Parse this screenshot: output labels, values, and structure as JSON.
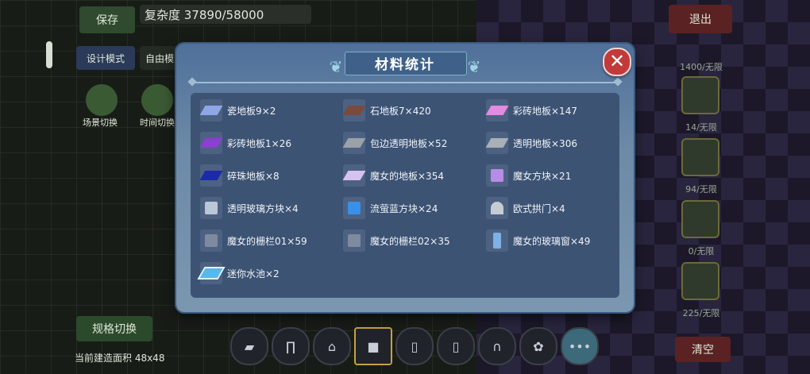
{
  "hud": {
    "save": "保存",
    "complexity": "复杂度 37890/58000",
    "design_mode": "设计模式",
    "free_mode": "自由模",
    "scene_switch": "场景切换",
    "time_switch": "时间切换",
    "spec_switch": "规格切换",
    "build_area": "当前建造面积 48x48",
    "exit": "退出",
    "clear": "清空",
    "right_counts": [
      "1400/无限",
      "14/无限",
      "94/无限",
      "0/无限",
      "225/无限"
    ]
  },
  "modal": {
    "title": "材料统计",
    "close_label": "✕",
    "items": [
      {
        "label": "瓷地板9×2",
        "icon": "tile-floor-icon",
        "color": "#8fa6e6"
      },
      {
        "label": "石地板7×420",
        "icon": "stone-floor-icon",
        "color": "#7a4a3c"
      },
      {
        "label": "彩砖地板×147",
        "icon": "color-brick-floor-icon",
        "color": "#e48ae0"
      },
      {
        "label": "彩砖地板1×26",
        "icon": "color-brick-floor-icon",
        "color": "#8c3fd0"
      },
      {
        "label": "包边透明地板×52",
        "icon": "edged-transparent-floor-icon",
        "color": "#9aa1a8"
      },
      {
        "label": "透明地板×306",
        "icon": "transparent-floor-icon",
        "color": "#a8b0b6"
      },
      {
        "label": "碎珠地板×8",
        "icon": "bead-floor-icon",
        "color": "#1c2aa8"
      },
      {
        "label": "魔女的地板×354",
        "icon": "witch-floor-icon",
        "color": "#d5c2f0"
      },
      {
        "label": "魔女方块×21",
        "icon": "witch-block-icon",
        "color": "#b88ce6"
      },
      {
        "label": "透明玻璃方块×4",
        "icon": "glass-block-icon",
        "color": "#b9c7d6"
      },
      {
        "label": "流萤蓝方块×24",
        "icon": "firefly-blue-block-icon",
        "color": "#3a8fe8"
      },
      {
        "label": "欧式拱门×4",
        "icon": "arch-door-icon",
        "color": "#c6ccd4"
      },
      {
        "label": "魔女的栅栏01×59",
        "icon": "witch-fence-icon",
        "color": "#7e8aa0"
      },
      {
        "label": "魔女的栅栏02×35",
        "icon": "witch-fence-icon",
        "color": "#7e8aa0"
      },
      {
        "label": "魔女的玻璃窗×49",
        "icon": "witch-window-icon",
        "color": "#7fb0e6"
      },
      {
        "label": "迷你水池×2",
        "icon": "mini-pool-icon",
        "color": "#58b8ec"
      }
    ]
  },
  "hotbar": [
    {
      "icon": "eraser-icon",
      "glyph": "▰"
    },
    {
      "icon": "door-frame-icon",
      "glyph": "∏"
    },
    {
      "icon": "gate-icon",
      "glyph": "⌂"
    },
    {
      "icon": "black-block-icon",
      "glyph": "■"
    },
    {
      "icon": "door-icon",
      "glyph": "▯"
    },
    {
      "icon": "white-door-icon",
      "glyph": "▯"
    },
    {
      "icon": "arch-icon",
      "glyph": "∩"
    },
    {
      "icon": "pink-bunny-icon",
      "glyph": "✿"
    },
    {
      "icon": "more-icon",
      "glyph": "•••"
    }
  ]
}
